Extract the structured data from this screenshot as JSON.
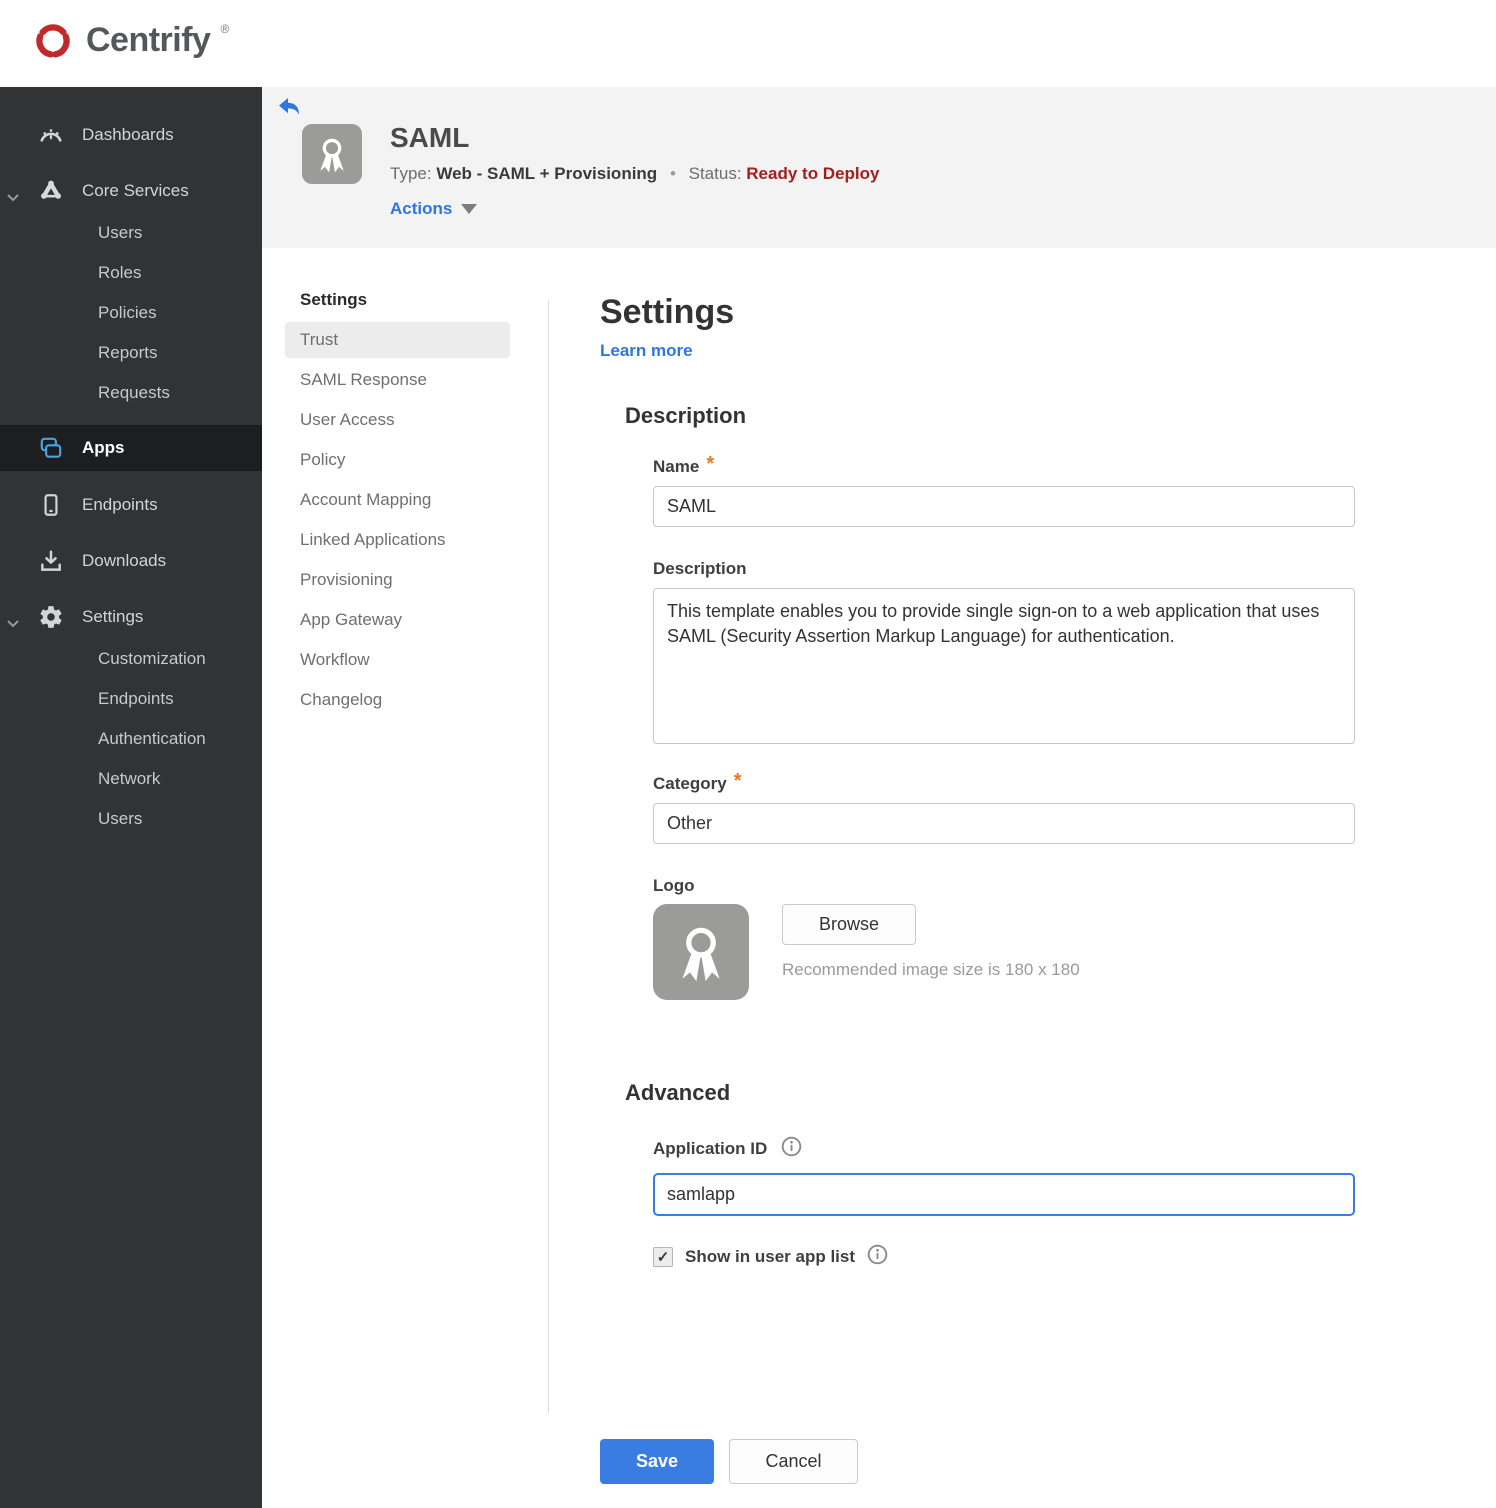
{
  "brand": {
    "name": "Centrify",
    "registered": "®"
  },
  "colors": {
    "accent_blue": "#2e76e0",
    "save_blue": "#3a7de2",
    "status_red": "#a61d1d",
    "required_orange": "#e87722",
    "sidebar_bg": "#313334",
    "sidebar_active_bg": "#1d1e1f",
    "header_band_bg": "#f3f3f3",
    "apps_icon_blue": "#4aa3e0",
    "brand_logo_red": "#c02a2a"
  },
  "page_header": {
    "title": "SAML",
    "type_label": "Type:",
    "type_value": "Web - SAML + Provisioning",
    "separator": "•",
    "status_label": "Status:",
    "status_value": "Ready to Deploy",
    "actions_label": "Actions"
  },
  "sidebar": {
    "dashboards": "Dashboards",
    "core_services": "Core Services",
    "core_items": [
      "Users",
      "Roles",
      "Policies",
      "Reports",
      "Requests"
    ],
    "apps": "Apps",
    "endpoints": "Endpoints",
    "downloads": "Downloads",
    "settings": "Settings",
    "settings_items": [
      "Customization",
      "Endpoints",
      "Authentication",
      "Network",
      "Users"
    ]
  },
  "subnav": {
    "heading": "Settings",
    "active_item": "Trust",
    "items": [
      "Trust",
      "SAML Response",
      "User Access",
      "Policy",
      "Account Mapping",
      "Linked Applications",
      "Provisioning",
      "App Gateway",
      "Workflow",
      "Changelog"
    ]
  },
  "main": {
    "heading": "Settings",
    "learn_more": "Learn more",
    "required_marker": "*",
    "description": {
      "heading": "Description",
      "name_label": "Name",
      "name_value": "SAML",
      "description_label": "Description",
      "description_value": "This template enables you to provide single sign-on to a web application that uses SAML (Security Assertion Markup Language) for authentication.",
      "category_label": "Category",
      "category_value": "Other",
      "logo_label": "Logo",
      "browse_label": "Browse",
      "logo_hint": "Recommended image size is 180 x 180"
    },
    "advanced": {
      "heading": "Advanced",
      "app_id_label": "Application ID",
      "app_id_value": "samlapp",
      "show_label": "Show in user app list",
      "checkbox_checked": true,
      "checkmark": "✓"
    },
    "footer": {
      "save_label": "Save",
      "cancel_label": "Cancel"
    }
  }
}
